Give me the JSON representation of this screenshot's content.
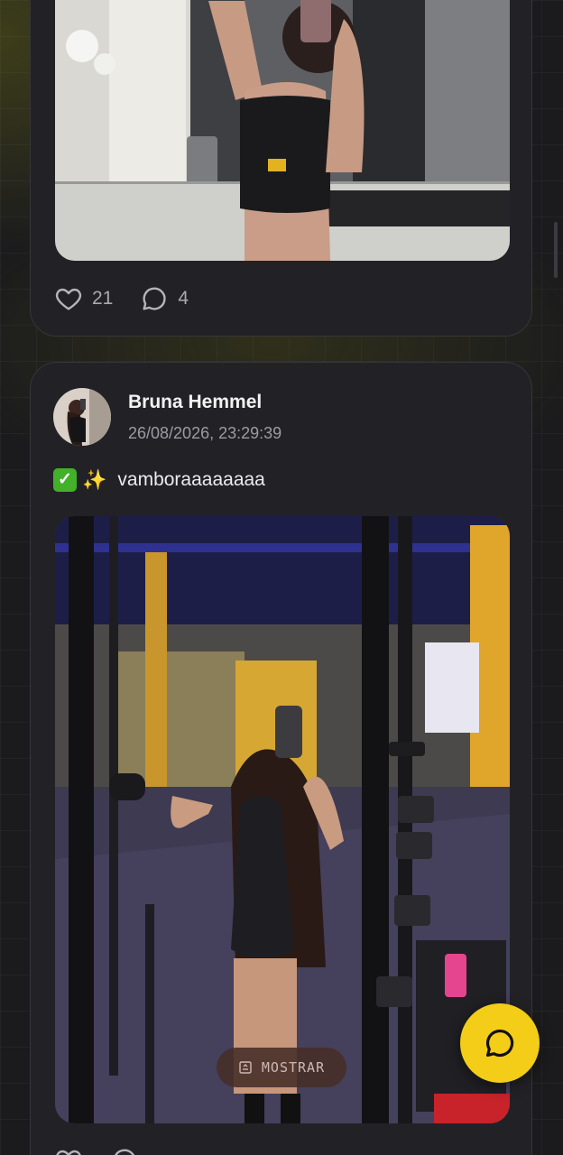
{
  "post1": {
    "likes": "21",
    "comments": "4"
  },
  "post2": {
    "author": "Bruna Hemmel",
    "timestamp": "26/08/2026, 23:29:39",
    "caption_text": "vamboraaaaaaaa",
    "caption_emojis": [
      "check-mark-button",
      "sparkles"
    ],
    "reveal_label": "MOSTRAR"
  },
  "colors": {
    "accent": "#f3cd17",
    "card": "#222226",
    "background": "#1b1b1d"
  }
}
